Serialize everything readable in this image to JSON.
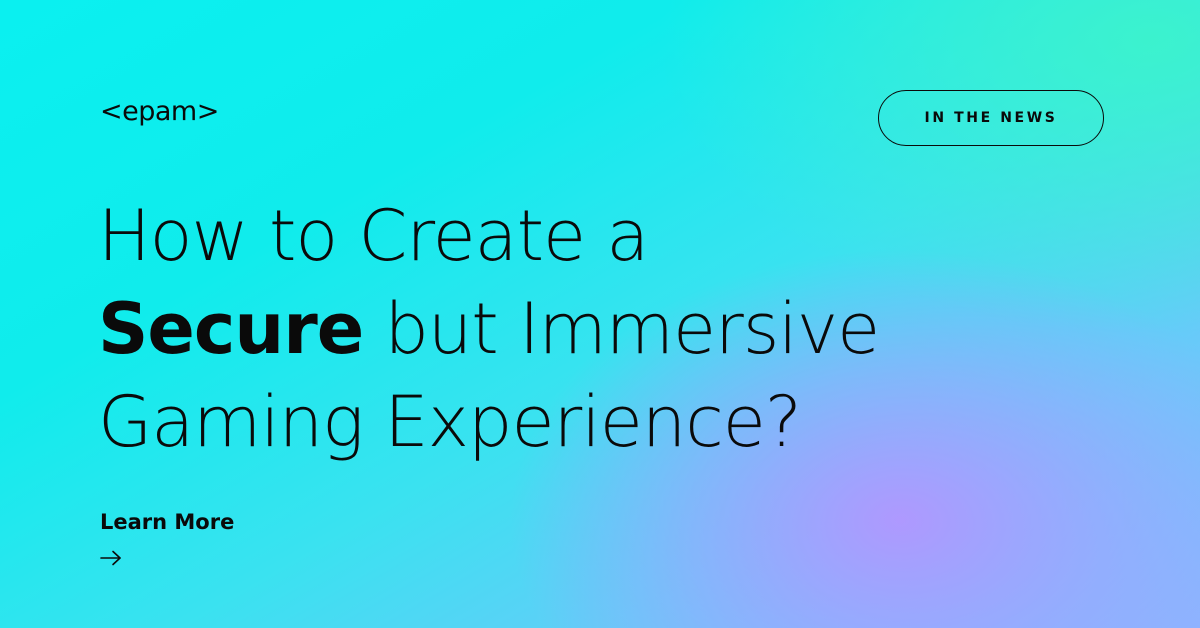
{
  "brand": {
    "logo_text": "<epam>"
  },
  "badge": {
    "label": "IN THE NEWS"
  },
  "headline": {
    "line1": "How to Create a",
    "line2_bold": "Secure",
    "line2_rest": " but Immersive",
    "line3": "Gaming Experience?"
  },
  "cta": {
    "label": "Learn More",
    "icon": "arrow-right-icon"
  },
  "colors": {
    "text": "#0a0a0a",
    "gradient_start": "#0af0f0",
    "gradient_mid": "#6cc8fa",
    "gradient_purple": "#b296ff"
  }
}
